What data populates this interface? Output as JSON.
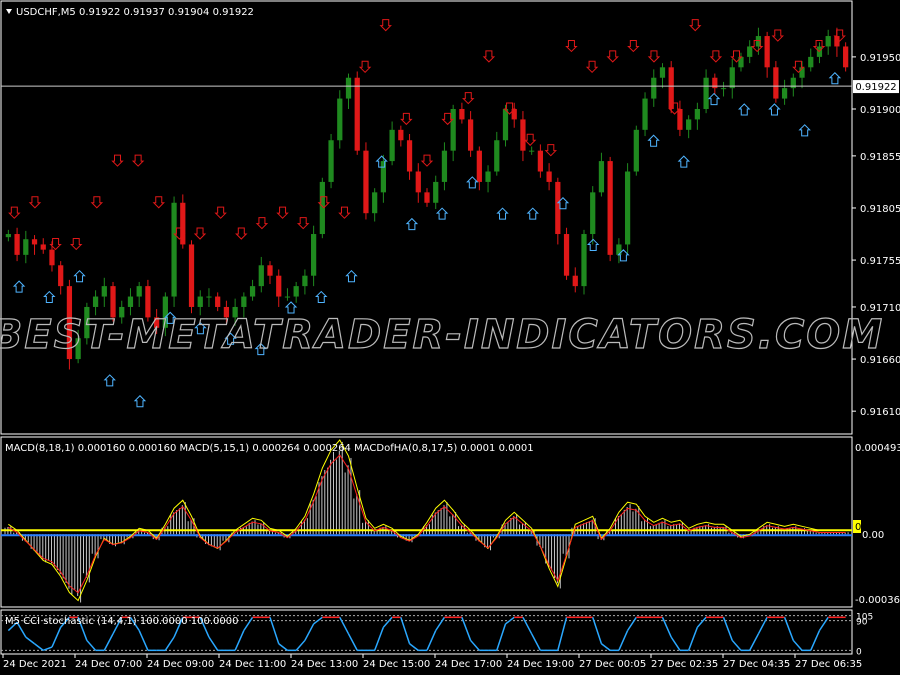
{
  "colors": {
    "background": "#000000",
    "bull": "#1f8a1f",
    "bear": "#e01818",
    "sell_arrow": "#e01818",
    "buy_arrow": "#4fb4ff",
    "grid_frame": "#ffffff",
    "macd_hist": "#c8c8c8",
    "macd_yellow": "#ffff00",
    "macd_red": "#ff2020",
    "macd_blue": "#2a7fff",
    "stoch_red": "#ff2020",
    "stoch_blue": "#2aa8ff"
  },
  "main": {
    "header": "USDCHF,M5  0.91922 0.91937 0.91904 0.91922",
    "price_label": "0.91922",
    "watermark": "BEST-METATRADER-INDICATORS.COM"
  },
  "macd": {
    "header": "MACD(8,18,1) 0.000160 0.000160  MACD(5,15,1) 0.000264 0.000264  MACDofHA(0,8,17,5) 0.0001 0.0001",
    "zero_label": "0"
  },
  "stoch": {
    "header": "M5 CCI stochastic (14,4,1) 100.0000 100.0000"
  },
  "chart_data": [
    {
      "type": "candlestick",
      "title": "USDCHF,M5",
      "ohlc_header": [
        0.91922,
        0.91937,
        0.91904,
        0.91922
      ],
      "ylim": [
        0.9159,
        0.91995
      ],
      "y_ticks": [
        "0.91950",
        "0.91900",
        "0.91855",
        "0.91805",
        "0.91755",
        "0.91710",
        "0.91660",
        "0.91610"
      ],
      "current_price": 0.91922,
      "x_tick_labels": [
        "24 Dec 2021",
        "24 Dec 07:00",
        "24 Dec 09:00",
        "24 Dec 11:00",
        "24 Dec 13:00",
        "24 Dec 15:00",
        "24 Dec 17:00",
        "24 Dec 19:00",
        "27 Dec 00:05",
        "27 Dec 02:35",
        "27 Dec 04:35",
        "27 Dec 06:35"
      ],
      "series": [
        {
          "name": "close",
          "values": [
            0.9178,
            0.9176,
            0.91775,
            0.9177,
            0.91765,
            0.9175,
            0.9173,
            0.9166,
            0.9168,
            0.9171,
            0.9172,
            0.9173,
            0.917,
            0.9171,
            0.9172,
            0.9173,
            0.917,
            0.9169,
            0.9172,
            0.9181,
            0.9177,
            0.9171,
            0.9172,
            0.9172,
            0.9171,
            0.917,
            0.9171,
            0.9172,
            0.9173,
            0.9175,
            0.9174,
            0.9172,
            0.9172,
            0.9173,
            0.9174,
            0.9178,
            0.9183,
            0.9187,
            0.9191,
            0.9193,
            0.9186,
            0.918,
            0.9182,
            0.9185,
            0.9188,
            0.9187,
            0.9184,
            0.9182,
            0.9181,
            0.9183,
            0.9186,
            0.919,
            0.9189,
            0.9186,
            0.9183,
            0.9184,
            0.9187,
            0.919,
            0.9189,
            0.9186,
            0.9186,
            0.9184,
            0.9183,
            0.9178,
            0.9174,
            0.9173,
            0.9178,
            0.9182,
            0.9185,
            0.9176,
            0.9177,
            0.9184,
            0.9188,
            0.9191,
            0.9193,
            0.9194,
            0.919,
            0.9188,
            0.9189,
            0.919,
            0.9193,
            0.9192,
            0.9192,
            0.9194,
            0.9195,
            0.9196,
            0.9197,
            0.9194,
            0.9191,
            0.9192,
            0.9193,
            0.9194,
            0.9195,
            0.9196,
            0.9197,
            0.9196,
            0.9194
          ]
        },
        {
          "name": "sell_signals",
          "values": [
            0.918,
            0.9181,
            0.9177,
            0.9177,
            0.9181,
            0.9185,
            0.9185,
            0.9181,
            0.9178,
            0.9178,
            0.918,
            0.9178,
            0.9179,
            0.918,
            0.9179,
            0.9181,
            0.918,
            0.9194,
            0.9198,
            0.9189,
            0.9185,
            0.9189,
            0.9191,
            0.9195,
            0.919,
            0.9187,
            0.9186,
            0.9196,
            0.9194,
            0.9195,
            0.9196,
            0.9195,
            0.919,
            0.9198,
            0.9195,
            0.9195,
            0.9196,
            0.9197,
            0.9194,
            0.9196,
            0.9197
          ]
        },
        {
          "name": "buy_signals",
          "values": [
            0.9173,
            0.9172,
            0.9174,
            0.9164,
            0.9162,
            0.917,
            0.9169,
            0.9168,
            0.9167,
            0.9171,
            0.9172,
            0.9174,
            0.9185,
            0.9179,
            0.918,
            0.9183,
            0.918,
            0.918,
            0.9181,
            0.9177,
            0.9176,
            0.9187,
            0.9185,
            0.9191,
            0.919,
            0.919,
            0.9188,
            0.9193
          ]
        }
      ]
    },
    {
      "type": "bar",
      "title": "MACD(8,18,1)",
      "header_values": [
        0.00016,
        0.00016
      ],
      "ylim": [
        -0.000365,
        0.000493
      ],
      "y_ticks": [
        "0.000493",
        "0.00",
        "-0.000365"
      ],
      "series": [
        {
          "name": "MACD(8,18,1)",
          "values": [
            4e-05,
            1e-05,
            -4e-05,
            -9e-05,
            -0.00014,
            -0.00016,
            -0.00022,
            -0.0003,
            -0.00034,
            -0.00024,
            -0.00012,
            -3e-05,
            -6e-05,
            -5e-05,
            -2e-05,
            2e-05,
            1e-05,
            -3e-05,
            4e-05,
            0.00012,
            0.00016,
            8e-05,
            -2e-05,
            -6e-05,
            -8e-05,
            -4e-05,
            1e-05,
            4e-05,
            7e-05,
            6e-05,
            2e-05,
            1e-05,
            -2e-05,
            2e-05,
            8e-05,
            0.00019,
            0.00032,
            0.00041,
            0.00046,
            0.00038,
            0.00022,
            7e-05,
            2e-05,
            4e-05,
            2e-05,
            -2e-05,
            -4e-05,
            -1e-05,
            5e-05,
            0.00012,
            0.00016,
            0.00011,
            5e-05,
            1e-05,
            -4e-05,
            -8e-05,
            -2e-05,
            6e-05,
            0.0001,
            6e-05,
            2e-05,
            -7e-05,
            -0.00018,
            -0.00027,
            -0.00012,
            4e-05,
            6e-05,
            8e-05,
            -3e-05,
            2e-05,
            0.0001,
            0.00015,
            0.00014,
            8e-05,
            5e-05,
            7e-05,
            5e-05,
            6e-05,
            2e-05,
            4e-05,
            5e-05,
            4e-05,
            4e-05,
            1e-05,
            -2e-05,
            -1e-05,
            2e-05,
            5e-05,
            4e-05,
            3e-05,
            4e-05,
            3e-05,
            2e-05,
            1e-05,
            1e-05,
            1e-05,
            1e-05
          ]
        }
      ]
    },
    {
      "type": "line",
      "title": "M5 CCI stochastic (14,4,1)",
      "header_values": [
        100.0,
        100.0
      ],
      "levels": [
        105,
        90,
        0
      ],
      "ylim": [
        -5,
        110
      ],
      "series": [
        {
          "name": "CCI stochastic",
          "values": [
            60,
            85,
            40,
            20,
            0,
            10,
            70,
            100,
            100,
            30,
            0,
            0,
            50,
            100,
            100,
            60,
            0,
            0,
            0,
            40,
            100,
            100,
            100,
            40,
            0,
            0,
            0,
            60,
            100,
            100,
            100,
            20,
            0,
            0,
            30,
            80,
            100,
            100,
            100,
            50,
            0,
            0,
            0,
            70,
            100,
            100,
            20,
            0,
            0,
            60,
            100,
            100,
            100,
            30,
            0,
            0,
            0,
            80,
            100,
            100,
            50,
            0,
            0,
            0,
            100,
            100,
            100,
            100,
            20,
            0,
            0,
            60,
            100,
            100,
            100,
            100,
            40,
            0,
            0,
            70,
            100,
            100,
            100,
            30,
            0,
            0,
            50,
            100,
            100,
            100,
            30,
            0,
            0,
            60,
            100,
            100,
            100
          ]
        }
      ]
    }
  ]
}
